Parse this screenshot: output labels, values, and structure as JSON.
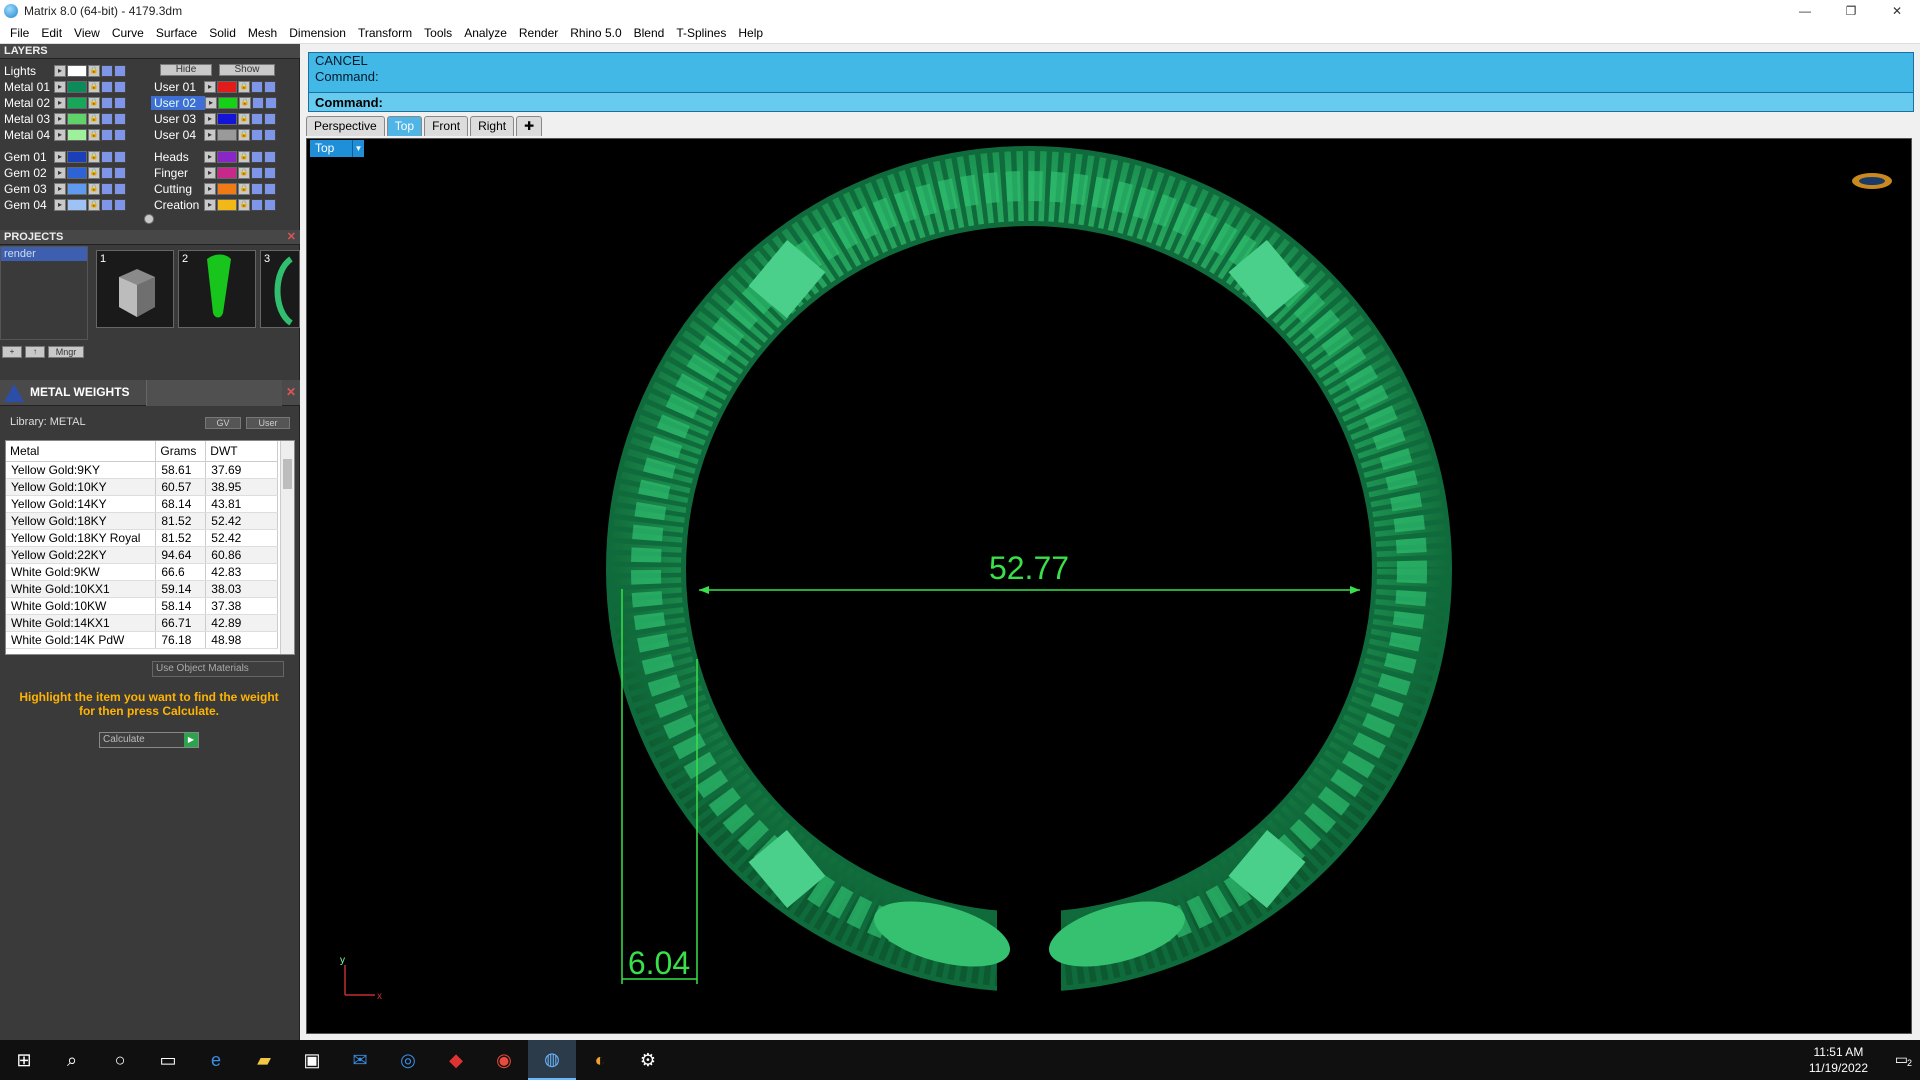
{
  "window": {
    "title": "Matrix 8.0 (64-bit) - 4179.3dm"
  },
  "menu": [
    "File",
    "Edit",
    "View",
    "Curve",
    "Surface",
    "Solid",
    "Mesh",
    "Dimension",
    "Transform",
    "Tools",
    "Analyze",
    "Render",
    "Rhino 5.0",
    "Blend",
    "T-Splines",
    "Help"
  ],
  "layers": {
    "header": "LAYERS",
    "hide_label": "Hide",
    "show_label": "Show",
    "left": [
      {
        "name": "Lights",
        "color": "#ffffff"
      },
      {
        "name": "Metal 01",
        "color": "#0c8a5a"
      },
      {
        "name": "Metal 02",
        "color": "#17a65a"
      },
      {
        "name": "Metal 03",
        "color": "#5fd36a"
      },
      {
        "name": "Metal 04",
        "color": "#9ff09a"
      },
      {
        "name": "Gem 01",
        "color": "#1a3fb8"
      },
      {
        "name": "Gem 02",
        "color": "#2d63d6"
      },
      {
        "name": "Gem 03",
        "color": "#5f9af0"
      },
      {
        "name": "Gem 04",
        "color": "#9fc2f6"
      }
    ],
    "right": [
      {
        "name": "User 01",
        "color": "#e21b1b"
      },
      {
        "name": "User 02",
        "color": "#14d214",
        "selected": true
      },
      {
        "name": "User 03",
        "color": "#1414d8"
      },
      {
        "name": "User 04",
        "color": "#9a9a9a"
      },
      {
        "name": "Heads",
        "color": "#8a25c8"
      },
      {
        "name": "Finger",
        "color": "#c8288a"
      },
      {
        "name": "Cutting",
        "color": "#f07a15"
      },
      {
        "name": "Creation",
        "color": "#f2b818"
      }
    ]
  },
  "projects": {
    "header": "PROJECTS",
    "list": [
      "render"
    ],
    "thumbs": [
      "1",
      "2",
      "3"
    ],
    "mngr_label": "Mngr"
  },
  "metal_weights": {
    "header": "METAL WEIGHTS",
    "library": "Library: METAL",
    "btn_gv": "GV",
    "btn_user": "User",
    "columns": [
      "Metal",
      "Grams",
      "DWT"
    ],
    "rows": [
      [
        "Yellow Gold:9KY",
        "58.61",
        "37.69"
      ],
      [
        "Yellow Gold:10KY",
        "60.57",
        "38.95"
      ],
      [
        "Yellow Gold:14KY",
        "68.14",
        "43.81"
      ],
      [
        "Yellow Gold:18KY",
        "81.52",
        "52.42"
      ],
      [
        "Yellow Gold:18KY Royal",
        "81.52",
        "52.42"
      ],
      [
        "Yellow Gold:22KY",
        "94.64",
        "60.86"
      ],
      [
        "White Gold:9KW",
        "66.6",
        "42.83"
      ],
      [
        "White Gold:10KX1",
        "59.14",
        "38.03"
      ],
      [
        "White Gold:10KW",
        "58.14",
        "37.38"
      ],
      [
        "White Gold:14KX1",
        "66.71",
        "42.89"
      ],
      [
        "White Gold:14K PdW",
        "76.18",
        "48.98"
      ]
    ],
    "use_object_materials": "Use Object Materials",
    "hint": "Highlight the item you want to find the weight for then press Calculate.",
    "calculate": "Calculate"
  },
  "command": {
    "line1": "CANCEL",
    "line2": "Command:",
    "prompt": "Command:"
  },
  "viewport_tabs": [
    "Perspective",
    "Top",
    "Front",
    "Right"
  ],
  "active_tab": "Top",
  "viewport": {
    "label": "Top",
    "dim_width": "52.77",
    "dim_height": "6.04",
    "axis_y": "y",
    "axis_x": "x"
  },
  "taskbar": {
    "time": "11:51 AM",
    "date": "11/19/2022",
    "notifications": "2"
  },
  "colors": {
    "cmd_bg": "#41b8e5",
    "ring": "#2fbf6f",
    "dimension": "#39e04a"
  }
}
